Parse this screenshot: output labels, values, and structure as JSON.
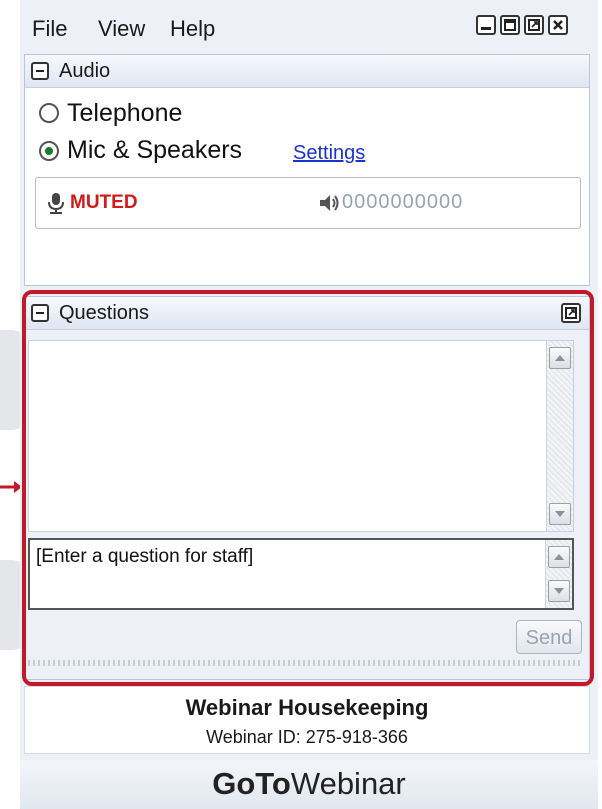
{
  "menu": {
    "file": "File",
    "view": "View",
    "help": "Help"
  },
  "audio": {
    "title": "Audio",
    "telephone_label": "Telephone",
    "mic_label": "Mic & Speakers",
    "settings_link": "Settings",
    "status": "MUTED",
    "meter": "0000000000",
    "selected": "Mic & Speakers"
  },
  "questions": {
    "title": "Questions",
    "input_placeholder": "[Enter a question for staff]",
    "send_label": "Send"
  },
  "footer": {
    "title": "Webinar Housekeeping",
    "webinar_id": "Webinar ID: 275-918-366",
    "brand_bold": "GoTo",
    "brand_light": "Webinar"
  },
  "colors": {
    "highlight": "#c21a2a",
    "muted": "#d11a1a",
    "link": "#1a33cc"
  }
}
